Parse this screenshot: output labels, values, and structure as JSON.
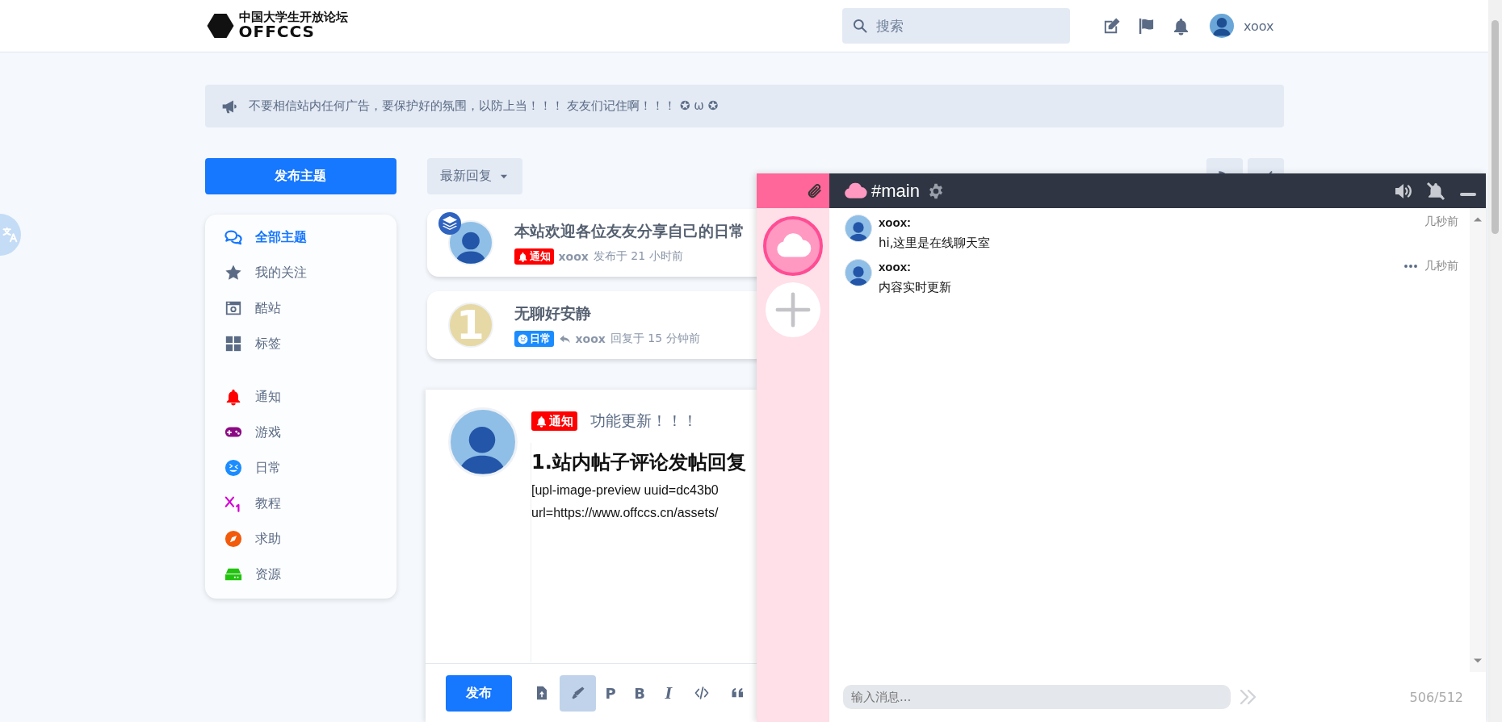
{
  "header": {
    "logo_title": "中国大学生开放论坛",
    "logo_subtitle": "OFFCCS",
    "search": {
      "placeholder": "搜索"
    },
    "username": "xoox"
  },
  "notice": "不要相信站内任何广告，要保护好的氛围，以防上当！！！ 友友们记住啊！！！ ✪ ω ✪",
  "start_button": "发布主题",
  "nav": [
    {
      "label": "全部主题",
      "selected": true
    },
    {
      "label": "我的关注",
      "selected": false
    },
    {
      "label": "酷站",
      "selected": false
    },
    {
      "label": "标签",
      "selected": false
    }
  ],
  "tags": [
    {
      "label": "通知",
      "color": "#ff0000"
    },
    {
      "label": "游戏",
      "color": "#8b0a84"
    },
    {
      "label": "日常",
      "color": "#1a8cff"
    },
    {
      "label": "教程",
      "color": "#d400d4"
    },
    {
      "label": "求助",
      "color": "#f25a0c"
    },
    {
      "label": "资源",
      "color": "#22c30f"
    }
  ],
  "sort_button": "最新回复",
  "discussions": [
    {
      "title": "本站欢迎各位友友分享自己的日常",
      "avatar": {
        "kind": "image"
      },
      "pinned": true,
      "tag": {
        "kind": "notice",
        "label": "通知",
        "color": "#ff0000"
      },
      "reply": false,
      "author": "xoox",
      "time": "发布于 21 小时前"
    },
    {
      "title": "无聊好安静",
      "avatar": {
        "kind": "letter",
        "text": "1",
        "color": "#e6d9a5"
      },
      "pinned": false,
      "tag": {
        "kind": "daily",
        "label": "日常",
        "color": "#1a8cff"
      },
      "reply": true,
      "author": "xoox",
      "time": "回复于 15 分钟前"
    }
  ],
  "composer": {
    "tag": {
      "kind": "notice",
      "label": "通知",
      "color": "#ff0000"
    },
    "title": "功能更新！！！",
    "heading": "1.站内帖子评论发帖回复",
    "lines": [
      "[upl-image-preview uuid=dc43b0",
      "url=https://www.offccs.cn/assets/"
    ],
    "submit": "发布",
    "toolbar": [
      {
        "kind": "upload",
        "selected": false
      },
      {
        "kind": "pen",
        "selected": true
      },
      {
        "kind": "text",
        "label": "P",
        "selected": false
      },
      {
        "kind": "text",
        "label": "B",
        "selected": false
      },
      {
        "kind": "text",
        "label": "I",
        "selected": false
      },
      {
        "kind": "code",
        "selected": false
      },
      {
        "kind": "quote",
        "selected": false
      }
    ]
  },
  "chat": {
    "channel": "#main",
    "rooms": [
      {
        "selected": true
      }
    ],
    "messages": [
      {
        "author": "xoox:",
        "time": "几秒前",
        "text": "hi,这里是在线聊天室",
        "menu": false
      },
      {
        "author": "xoox:",
        "time": "几秒前",
        "text": "内容实时更新",
        "menu": true
      }
    ],
    "input": {
      "placeholder": "输入消息..."
    },
    "counter": "506/512"
  }
}
